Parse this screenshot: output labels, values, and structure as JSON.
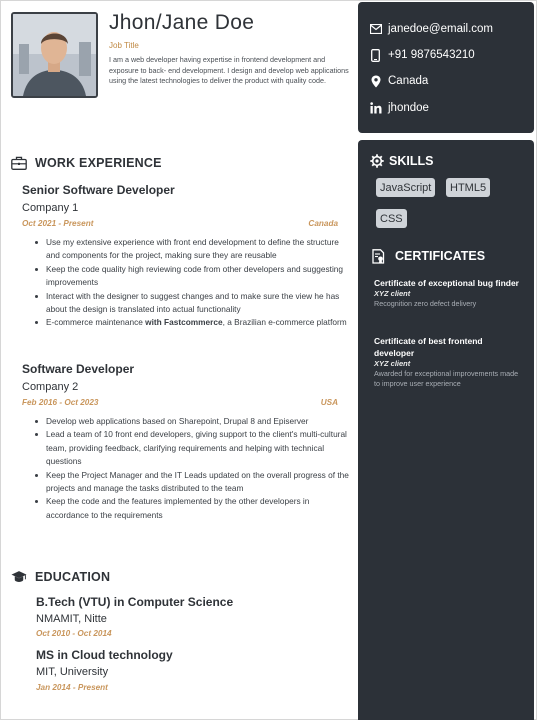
{
  "profile": {
    "name": "Jhon/Jane Doe",
    "job_title": "Job Title",
    "bio": "I am a web developer having expertise in frontend development and exposure to back- end development. I design and develop web applications using the latest technologies to deliver the product with quality code.",
    "photo_icon": "portrait-photo"
  },
  "contact": {
    "email": "janedoe@email.com",
    "phone": "+91 9876543210",
    "location": "Canada",
    "linkedin": "jhondoe",
    "icons": [
      "envelope-icon",
      "phone-icon",
      "location-pin-icon",
      "linkedin-icon"
    ]
  },
  "skills": {
    "heading": "SKILLS",
    "items": [
      "JavaScript",
      "HTML5",
      "CSS"
    ]
  },
  "certificates": {
    "heading": "CERTIFICATES",
    "items": [
      {
        "title": "Certificate of exceptional bug finder",
        "client": "XYZ client",
        "desc": "Recognition zero defect delivery"
      },
      {
        "title": "Certificate of best frontend developer",
        "client": "XYZ client",
        "desc": "Awarded for exceptional improvements made to improve user experience"
      }
    ]
  },
  "experience": {
    "heading": "WORK EXPERIENCE",
    "jobs": [
      {
        "role": "Senior Software Developer",
        "company": "Company 1",
        "dates": "Oct 2021 - Present",
        "location": "Canada",
        "bullets": [
          "Use my extensive experience with front end development to define the structure and components for the project, making sure they are reusable",
          "Keep the code quality high reviewing code from other developers and suggesting improvements",
          "Interact with the designer to suggest changes and to make sure the view he has about the design is translated into actual functionality",
          "E-commerce maintenance",
          "with Fastcommerce",
          ", a Brazilian e-commerce platform"
        ]
      },
      {
        "role": "Software Developer",
        "company": "Company 2",
        "dates": "Feb 2016 - Oct 2023",
        "location": "USA",
        "bullets": [
          "Develop web applications based on Sharepoint, Drupal 8 and Episerver",
          "Lead a team of 10 front end developers, giving support to the client's multi-cultural team, providing feedback, clarifying requirements and helping with technical questions",
          "Keep the Project Manager and the IT Leads updated on the overall progress of the projects and manage the tasks distributed to the team",
          "Keep the code and the features implemented by the other developers in accordance to the requirements"
        ]
      }
    ]
  },
  "education": {
    "heading": "EDUCATION",
    "items": [
      {
        "degree": "B.Tech (VTU) in Computer Science",
        "school": "NMAMIT, Nitte",
        "dates": "Oct 2010 - Oct 2014"
      },
      {
        "degree": "MS in Cloud technology",
        "school": "MIT, University",
        "dates": "Jan 2014 - Present"
      }
    ]
  },
  "colors": {
    "sidebar": "#2c3138",
    "accent": "#c9965c",
    "skill_chip": "#cfd3d8"
  }
}
